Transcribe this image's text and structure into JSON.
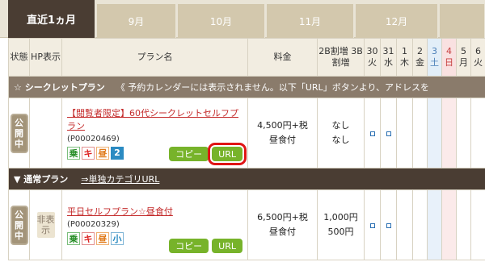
{
  "tabs": [
    {
      "label": "直近1ヵ月",
      "active": true
    },
    {
      "label": "9月"
    },
    {
      "label": "10月"
    },
    {
      "label": "11月"
    },
    {
      "label": "12月"
    }
  ],
  "headers": {
    "status": "状態",
    "hp": "HP表示",
    "plan_name": "プラン名",
    "price": "料金",
    "extra": "2B割増 3B割増",
    "days": [
      {
        "d": "30",
        "w": "火"
      },
      {
        "d": "31",
        "w": "水"
      },
      {
        "d": "1",
        "w": "木"
      },
      {
        "d": "2",
        "w": "金"
      },
      {
        "d": "3",
        "w": "土"
      },
      {
        "d": "4",
        "w": "日"
      },
      {
        "d": "5",
        "w": "月"
      },
      {
        "d": "6",
        "w": "火"
      }
    ]
  },
  "section_secret": {
    "label": "☆ シークレットプラン",
    "note": "《 予約カレンダーには表示されません。以下「URL」ボタンより、アドレスを"
  },
  "section_normal": {
    "label": "▼ 通常プラン",
    "link": "⇒単独カテゴリURL"
  },
  "rows": [
    {
      "status": "公開中",
      "hp": "",
      "title": "【閲覧者限定】60代シークレットセルフプラン",
      "code": "(P00020469)",
      "icons": [
        "乗",
        "キ",
        "昼",
        "2"
      ],
      "price": "4,500円+税",
      "meal": "昼食付",
      "extra1": "なし",
      "extra2": "なし",
      "copy": "コピー",
      "url": "URL"
    },
    {
      "status": "公開中",
      "hp": "非表示",
      "title": "平日セルフプラン☆昼食付",
      "code": "(P00020329)",
      "icons": [
        "乗",
        "キ",
        "昼",
        "小"
      ],
      "price": "6,500円+税",
      "meal": "昼食付",
      "extra1": "1,000円",
      "extra2": "500円",
      "copy": "コピー",
      "url": "URL"
    }
  ]
}
